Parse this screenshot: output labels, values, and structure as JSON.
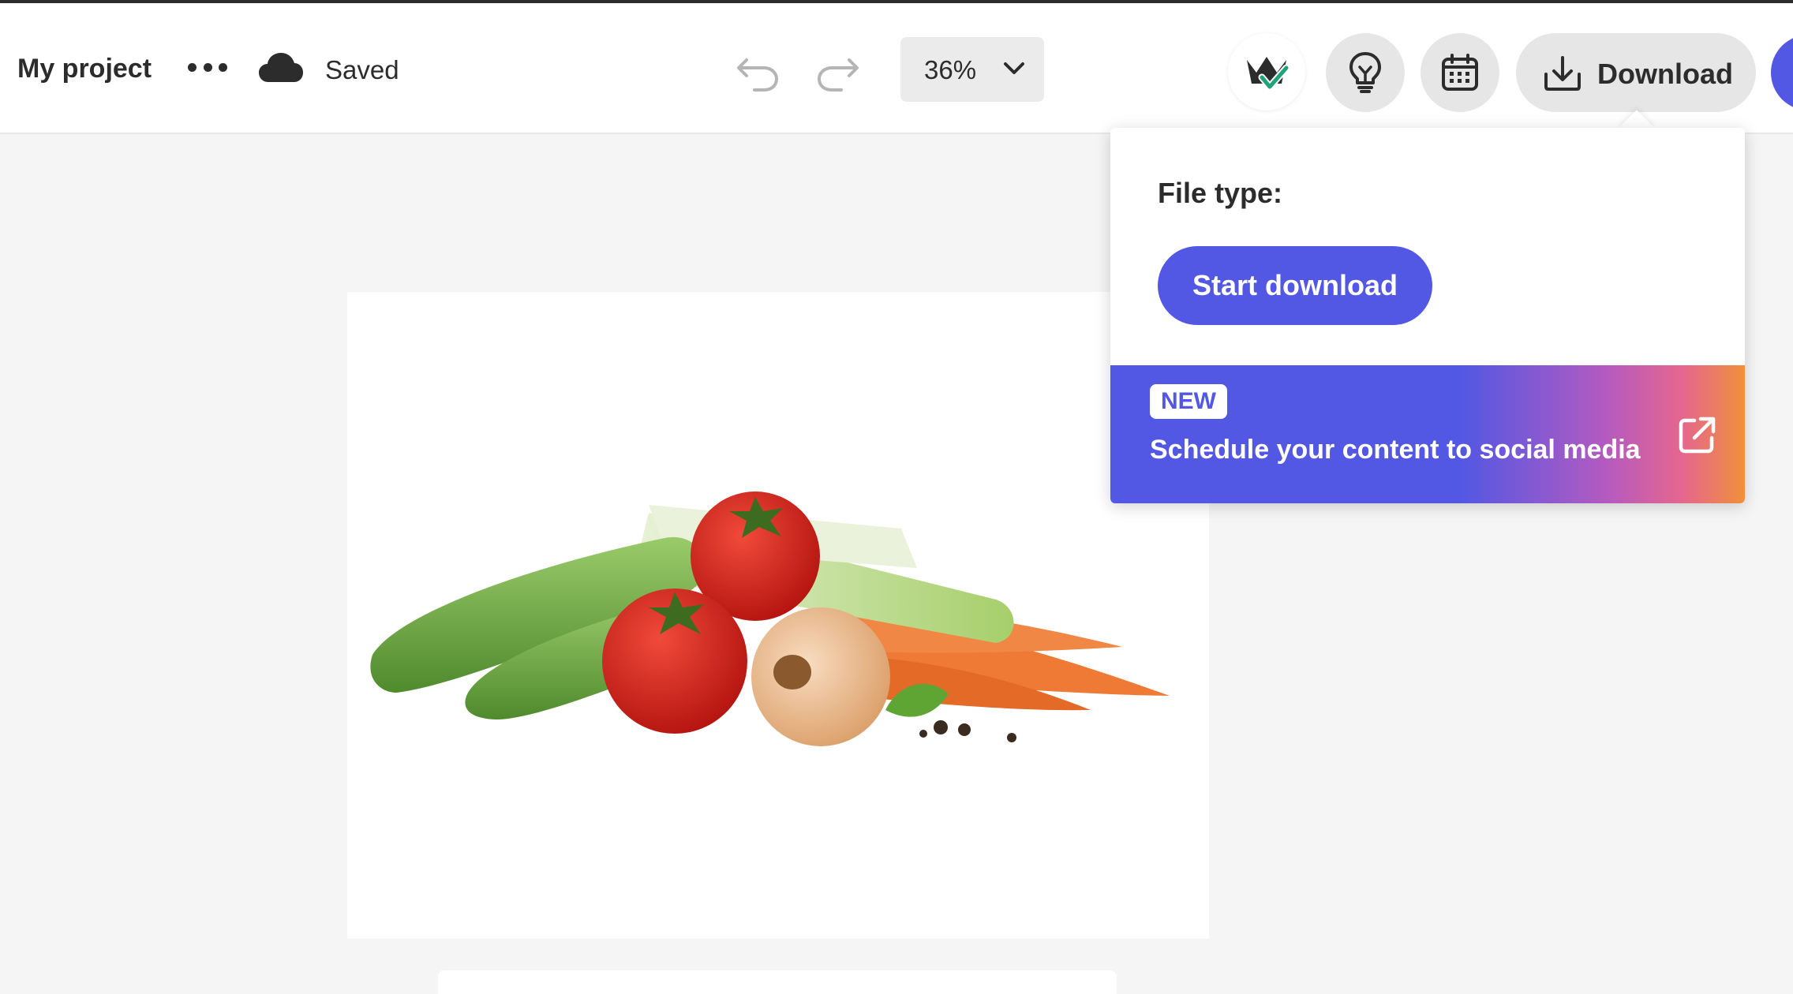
{
  "toolbar": {
    "project_title": "My project",
    "save_status": "Saved",
    "zoom_level": "36%",
    "download_label": "Download"
  },
  "icons": {
    "more": "more-icon",
    "cloud": "cloud-icon",
    "undo": "undo-icon",
    "redo": "redo-icon",
    "zoom_chevron": "chevron-down-icon",
    "premium": "crown-check-icon",
    "ideas": "lightbulb-icon",
    "schedule": "calendar-icon",
    "download": "download-icon",
    "external": "external-link-icon"
  },
  "download_popover": {
    "file_type_label": "File type:",
    "start_button": "Start download",
    "promo": {
      "badge": "NEW",
      "text": "Schedule your content to social media"
    }
  },
  "colors": {
    "accent": "#5258e4",
    "toolbar_bg": "#ffffff",
    "canvas_bg": "#f5f5f5",
    "button_bg": "#e6e6e6"
  }
}
